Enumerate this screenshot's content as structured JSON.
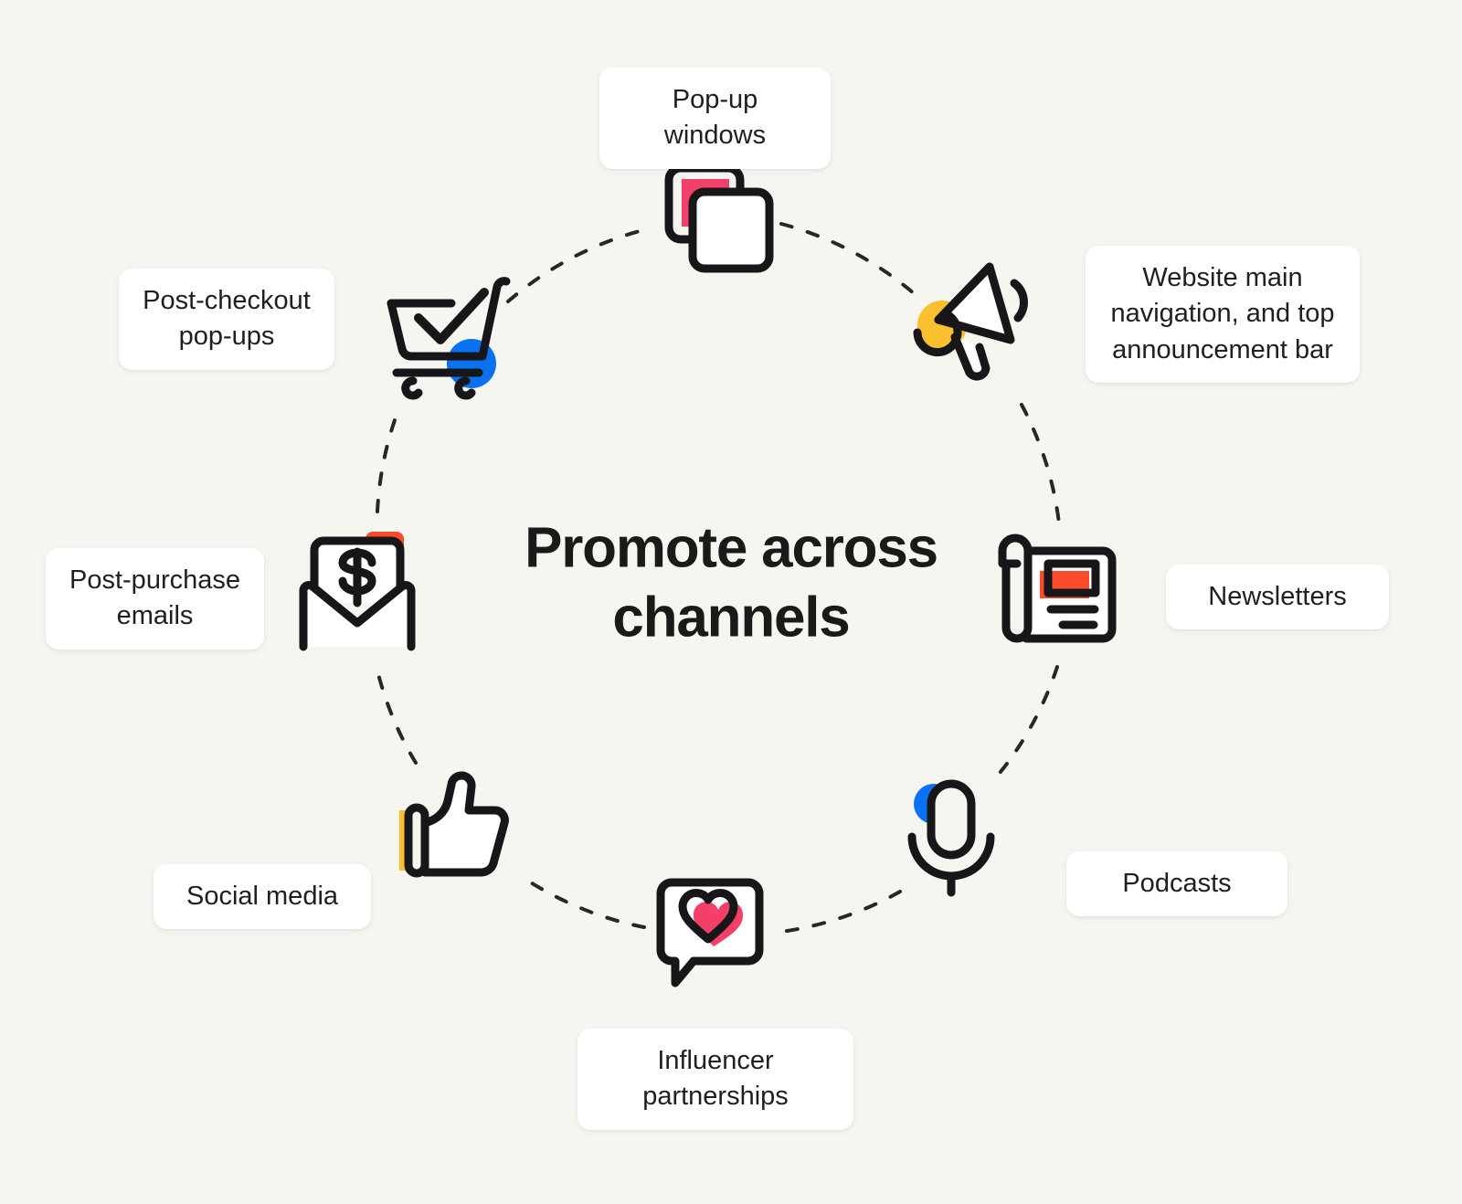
{
  "background_color": "#f7f5f0",
  "center": {
    "title": "Promote across\nchannels"
  },
  "palette": {
    "ink": "#17171a",
    "pink": "#f43f68",
    "yellow": "#fcc02e",
    "orange": "#fa4b2a",
    "blue": "#0a72f0",
    "card": "#ffffff",
    "background": "#f7f5f0"
  },
  "nodes": [
    {
      "id": "pop-up-windows",
      "icon": "overlapping-windows-icon",
      "label": "Pop-up windows",
      "label_lines": 1
    },
    {
      "id": "website-navigation",
      "icon": "megaphone-icon",
      "label": "Website main\nnavigation, and top\nannouncement bar",
      "label_lines": 3
    },
    {
      "id": "newsletters",
      "icon": "newspaper-icon",
      "label": "Newsletters",
      "label_lines": 1
    },
    {
      "id": "podcasts",
      "icon": "microphone-icon",
      "label": "Podcasts",
      "label_lines": 1
    },
    {
      "id": "influencer-partnerships",
      "icon": "chat-heart-icon",
      "label": "Influencer\npartnerships",
      "label_lines": 2
    },
    {
      "id": "social-media",
      "icon": "thumbs-up-icon",
      "label": "Social media",
      "label_lines": 1
    },
    {
      "id": "post-purchase-emails",
      "icon": "envelope-dollar-icon",
      "label": "Post-purchase\nemails",
      "label_lines": 2
    },
    {
      "id": "post-checkout-popups",
      "icon": "shopping-cart-check-icon",
      "label": "Post-checkout\npop-ups",
      "label_lines": 2
    }
  ]
}
